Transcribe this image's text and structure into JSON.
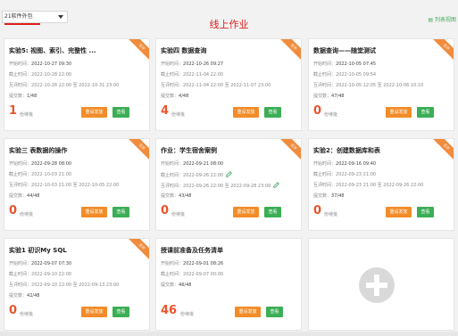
{
  "topbar": {
    "class_select": "21软件外包",
    "page_title": "线上作业",
    "list_view": "▤ 列表视图"
  },
  "labels": {
    "start": "开始时间：",
    "deadline": "截止时间：",
    "review": "互评时间：",
    "submitted": "提交数：",
    "pending": "份待批",
    "resend": "重设发放",
    "view": "查看",
    "ribbon": "互评"
  },
  "cards": [
    {
      "title": "实验5: 视图、索引、完整性 ...",
      "start": "2022-10-27 09:30",
      "deadline": "2022-10-28 22:00",
      "review": "2022-10-28 22:00 至 2022-10-31 23:00",
      "submitted": "1/48",
      "pending": "1",
      "ribbon": true,
      "edit": false
    },
    {
      "title": "实验四 数据查询",
      "start": "2022-10-26 09:27",
      "deadline": "2022-11-04 22:00",
      "review": "2022-11-04 22:00 至 2022-11-07 23:00",
      "submitted": "4/48",
      "pending": "4",
      "ribbon": true,
      "edit": false
    },
    {
      "title": "数据查询——随堂测试",
      "start": "2022-10-05 07:45",
      "deadline": "2022-10-05 09:54",
      "review": "2022-10-05 12:05 至 2022-10-06 10:10",
      "submitted": "47/48",
      "pending": "0",
      "ribbon": true,
      "edit": false
    },
    {
      "title": "实验三 表数据的操作",
      "start": "2022-09-28 08:00",
      "deadline": "2022-10-03 21:00",
      "review": "2022-10-03 21:00 至 2022-10-05 22:00",
      "submitted": "44/48",
      "pending": "0",
      "ribbon": true,
      "edit": false
    },
    {
      "title": "作业：学生宿舍案例",
      "start": "2022-09-21 08:00",
      "deadline": "2022-09-26 22:00",
      "review": "2022-09-26 22:00 至 2022-09-28 23:00",
      "submitted": "43/48",
      "pending": "0",
      "ribbon": true,
      "edit": true
    },
    {
      "title": "实验2：创建数据库和表",
      "start": "2022-09-16 09:40",
      "deadline": "2022-09-23 21:00",
      "review": "2022-09-23 21:00 至 2022-09-26 22:00",
      "submitted": "37/48",
      "pending": "0",
      "ribbon": true,
      "edit": false
    },
    {
      "title": "实验1 初识My SQL",
      "start": "2022-09-07 07:30",
      "deadline": "2022-09-10 22:00",
      "review": "2022-09-10 22:00 至 2022-09-13 23:00",
      "submitted": "42/48",
      "pending": "0",
      "ribbon": true,
      "edit": false
    },
    {
      "title": "授课前准备及任务清单",
      "start": "2022-09-01 08:26",
      "deadline": "2022-09-07 00:00",
      "review": "",
      "submitted": "46/48",
      "pending": "46",
      "ribbon": false,
      "edit": false
    }
  ],
  "colors": {
    "accent_red": "#e02020",
    "orange": "#f28c28",
    "green": "#3cae56",
    "count": "#e8542c"
  }
}
